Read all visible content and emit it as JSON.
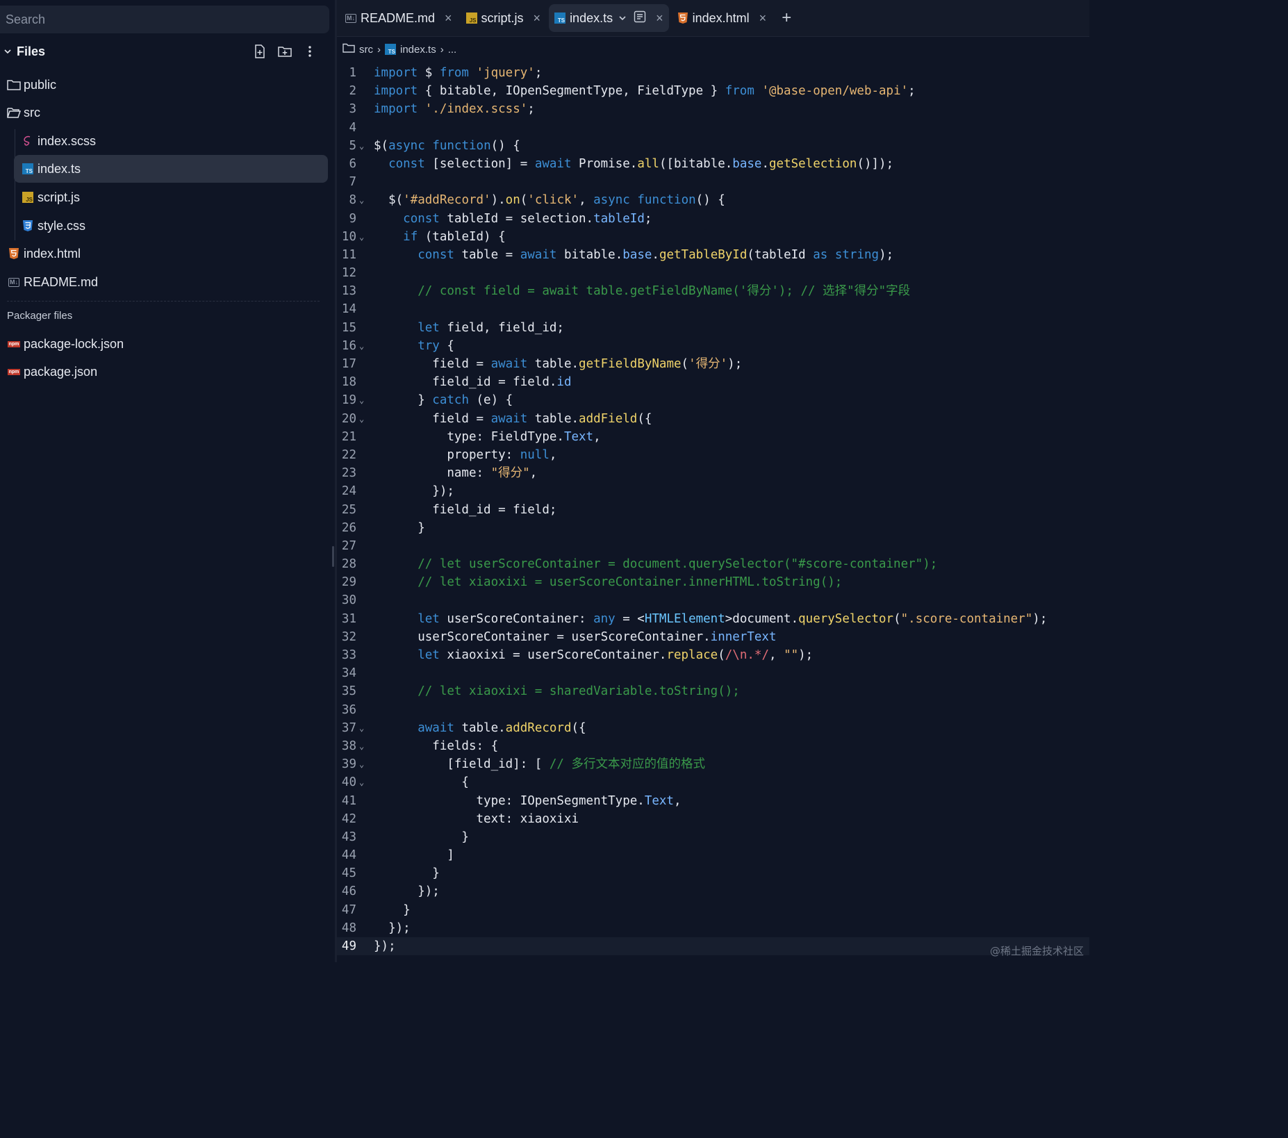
{
  "search": {
    "placeholder": "Search"
  },
  "files_panel": {
    "title": "Files",
    "actions": [
      "new-file-icon",
      "new-folder-icon",
      "more-icon"
    ],
    "tree": [
      {
        "label": "public",
        "icon": "folder-icon",
        "depth": 0
      },
      {
        "label": "src",
        "icon": "folder-open-icon",
        "depth": 0
      },
      {
        "label": "index.scss",
        "icon": "sass-icon",
        "depth": 1
      },
      {
        "label": "index.ts",
        "icon": "typescript-icon",
        "depth": 1,
        "selected": true
      },
      {
        "label": "script.js",
        "icon": "javascript-icon",
        "depth": 1
      },
      {
        "label": "style.css",
        "icon": "css-icon",
        "depth": 1
      },
      {
        "label": "index.html",
        "icon": "html-icon",
        "depth": 0
      },
      {
        "label": "README.md",
        "icon": "markdown-icon",
        "depth": 0
      }
    ],
    "packager_label": "Packager files",
    "packager_files": [
      {
        "label": "package-lock.json",
        "icon": "npm-icon"
      },
      {
        "label": "package.json",
        "icon": "npm-icon"
      }
    ]
  },
  "tabs": [
    {
      "label": "README.md",
      "icon": "markdown-icon",
      "active": false
    },
    {
      "label": "script.js",
      "icon": "javascript-icon",
      "active": false
    },
    {
      "label": "index.ts",
      "icon": "typescript-icon",
      "active": true
    },
    {
      "label": "index.html",
      "icon": "html-icon",
      "active": false
    }
  ],
  "breadcrumb": {
    "folder": "src",
    "file": "index.ts",
    "more": "..."
  },
  "code": {
    "current_line": 49,
    "folds": [
      5,
      8,
      10,
      16,
      19,
      20,
      37,
      38,
      39,
      40
    ],
    "lines": [
      "import $ from 'jquery';",
      "import { bitable, IOpenSegmentType, FieldType } from '@base-open/web-api';",
      "import './index.scss';",
      "",
      "$(async function() {",
      "  const [selection] = await Promise.all([bitable.base.getSelection()]);",
      "",
      "  $('#addRecord').on('click', async function() {",
      "    const tableId = selection.tableId;",
      "    if (tableId) {",
      "      const table = await bitable.base.getTableById(tableId as string);",
      "",
      "      // const field = await table.getFieldByName('得分'); // 选择\"得分\"字段",
      "",
      "      let field, field_id;",
      "      try {",
      "        field = await table.getFieldByName('得分');",
      "        field_id = field.id",
      "      } catch (e) {",
      "        field = await table.addField({",
      "          type: FieldType.Text,",
      "          property: null,",
      "          name: \"得分\",",
      "        });",
      "        field_id = field;",
      "      }",
      "",
      "      // let userScoreContainer = document.querySelector(\"#score-container\");",
      "      // let xiaoxixi = userScoreContainer.innerHTML.toString();",
      "",
      "      let userScoreContainer: any = <HTMLElement>document.querySelector(\".score-container\");",
      "      userScoreContainer = userScoreContainer.innerText",
      "      let xiaoxixi = userScoreContainer.replace(/\\n.*/, \"\");",
      "",
      "      // let xiaoxixi = sharedVariable.toString();",
      "",
      "      await table.addRecord({",
      "        fields: {",
      "          [field_id]: [ // 多行文本对应的值的格式",
      "            {",
      "              type: IOpenSegmentType.Text,",
      "              text: xiaoxixi",
      "            }",
      "          ]",
      "        }",
      "      });",
      "    }",
      "  });",
      "});"
    ]
  },
  "watermark": "@稀土掘金技术社区",
  "colors": {
    "background": "#0f1525",
    "keyword": "#3d8fd6",
    "string": "#e6b673",
    "function": "#f0d46a",
    "comment": "#3a9a4a",
    "selected_row": "#2b3242"
  }
}
